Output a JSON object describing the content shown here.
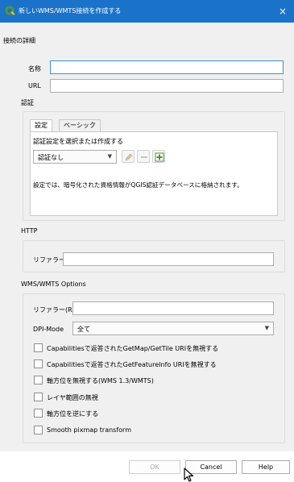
{
  "window": {
    "title": "新しいWMS/WMTS接続を作成する",
    "close_glyph": "×"
  },
  "connection_details": {
    "heading": "接続の詳細",
    "name_label": "名称",
    "name_value": "",
    "url_label": "URL",
    "url_value": ""
  },
  "auth": {
    "heading": "認証",
    "tabs": [
      "設定",
      "ベーシック"
    ],
    "select_label": "認証設定を選択または作成する",
    "selected_config": "認証なし",
    "info_text": "設定では、暗号化された資格情報がQGIS認証データベースに格納されます。"
  },
  "http": {
    "heading": "HTTP",
    "referer_label": "リファラー",
    "referer_value": ""
  },
  "options": {
    "heading": "WMS/WMTS Options",
    "referer_label": "リファラー(R)",
    "referer_value": "",
    "dpi_label": "DPI-Mode",
    "dpi_value": "全て",
    "checkboxes": [
      {
        "label": "Capabilitiesで返答されたGetMap/GetTile URIを無視する",
        "checked": false
      },
      {
        "label": "Capabilitiesで返答されたGetFeatureInfo URIを無視する",
        "checked": false
      },
      {
        "label": "軸方位を無視する(WMS 1.3/WMTS)",
        "checked": false
      },
      {
        "label": "レイヤ範囲の無視",
        "checked": false
      },
      {
        "label": "軸方位を逆にする",
        "checked": false
      },
      {
        "label": "Smooth pixmap transform",
        "checked": false
      }
    ]
  },
  "buttons": {
    "ok": "OK",
    "cancel": "Cancel",
    "help": "Help"
  },
  "colors": {
    "titlebar": "#1a73c9",
    "qgis_green": "#589632",
    "focus": "#3c8fd8"
  }
}
